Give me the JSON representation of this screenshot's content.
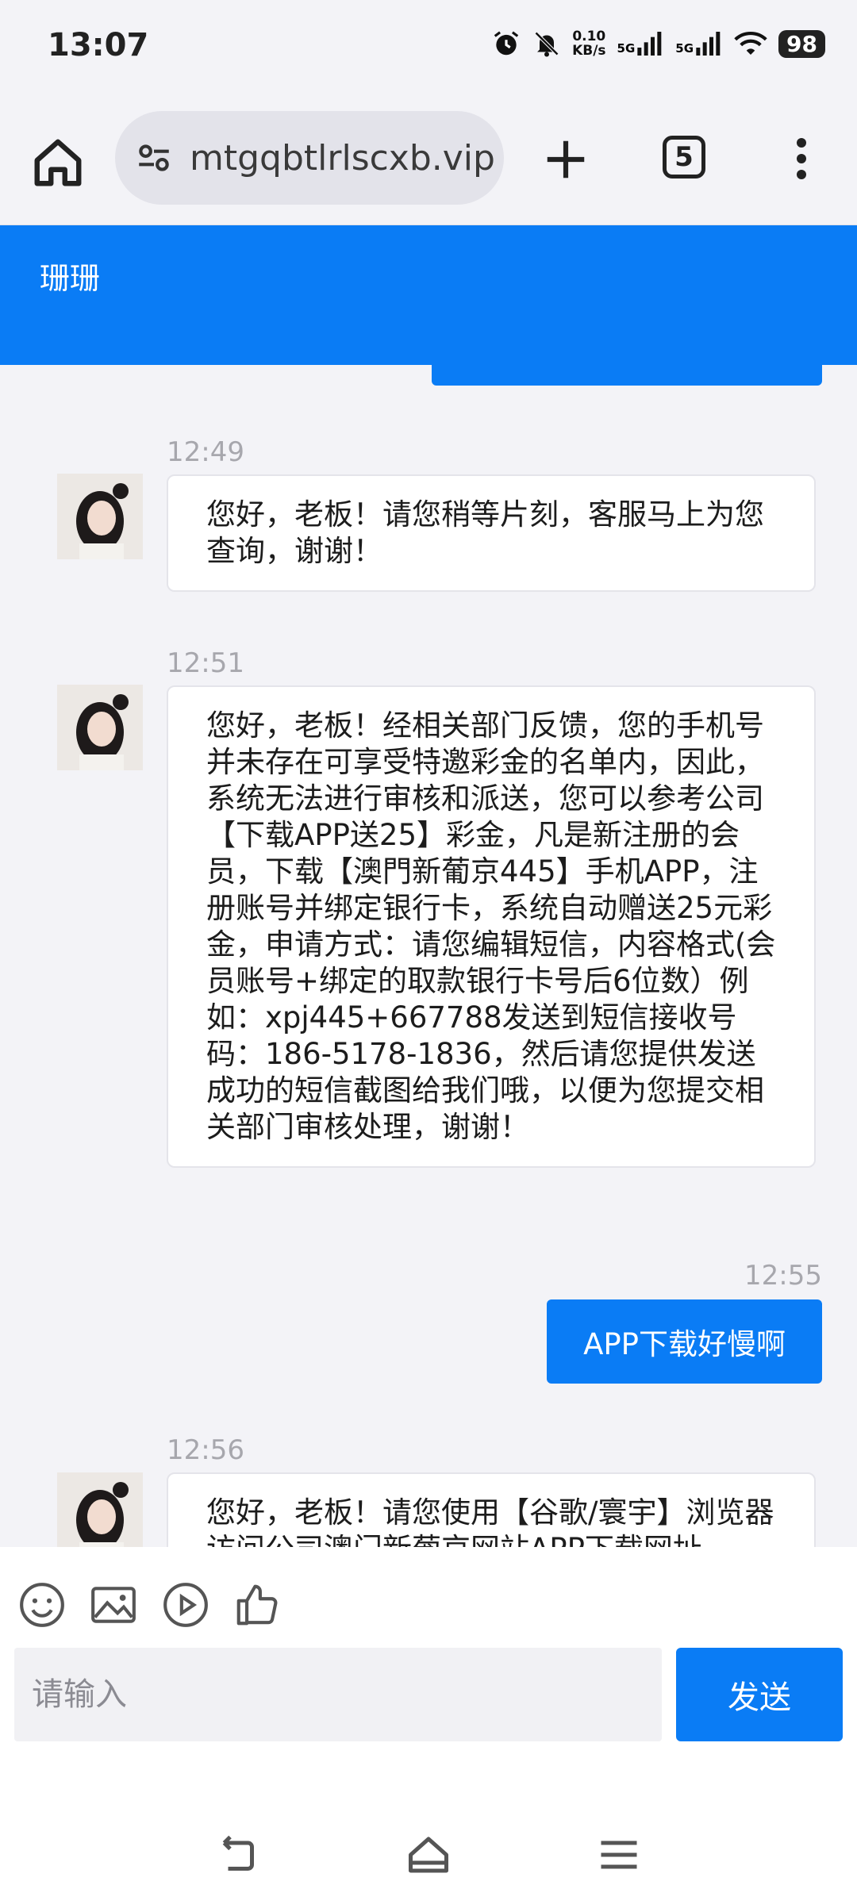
{
  "status": {
    "time": "13:07",
    "net_speed_value": "0.10",
    "net_speed_unit": "KB/s",
    "sim1": "5G",
    "sim2": "5G",
    "battery": "98"
  },
  "browser": {
    "url": "mtgqbtlrlscxb.vip",
    "tab_count": "5"
  },
  "chat": {
    "title": "珊珊",
    "messages": [
      {
        "time": "12:49",
        "text": "您好，老板！请您稍等片刻，客服马上为您查询，谢谢！"
      },
      {
        "time": "12:51",
        "text": "您好，老板！经相关部门反馈，您的手机号并未存在可享受特邀彩金的名单内，因此，系统无法进行审核和派送，您可以参考公司【下载APP送25】彩金，凡是新注册的会员，下载【澳門新葡京445】手机APP，注册账号并绑定银行卡，系统自动赠送25元彩金，申请方式：请您编辑短信，内容格式(会员账号+绑定的取款银行卡号后6位数）例如：xpj445+667788发送到短信接收号码：186-5178-1836，然后请您提供发送成功的短信截图给我们哦，以便为您提交相关部门审核处理，谢谢！"
      },
      {
        "time": "12:55",
        "text": "APP下载好慢啊"
      },
      {
        "time": "12:56",
        "text": "您好，老板！请您使用【谷歌/寰宇】浏览器访问公司澳门新葡京网站APP下载网址"
      }
    ]
  },
  "input": {
    "placeholder": "请输入",
    "send_label": "发送"
  },
  "colors": {
    "accent": "#0a7cf5",
    "background": "#f3f3f7"
  }
}
